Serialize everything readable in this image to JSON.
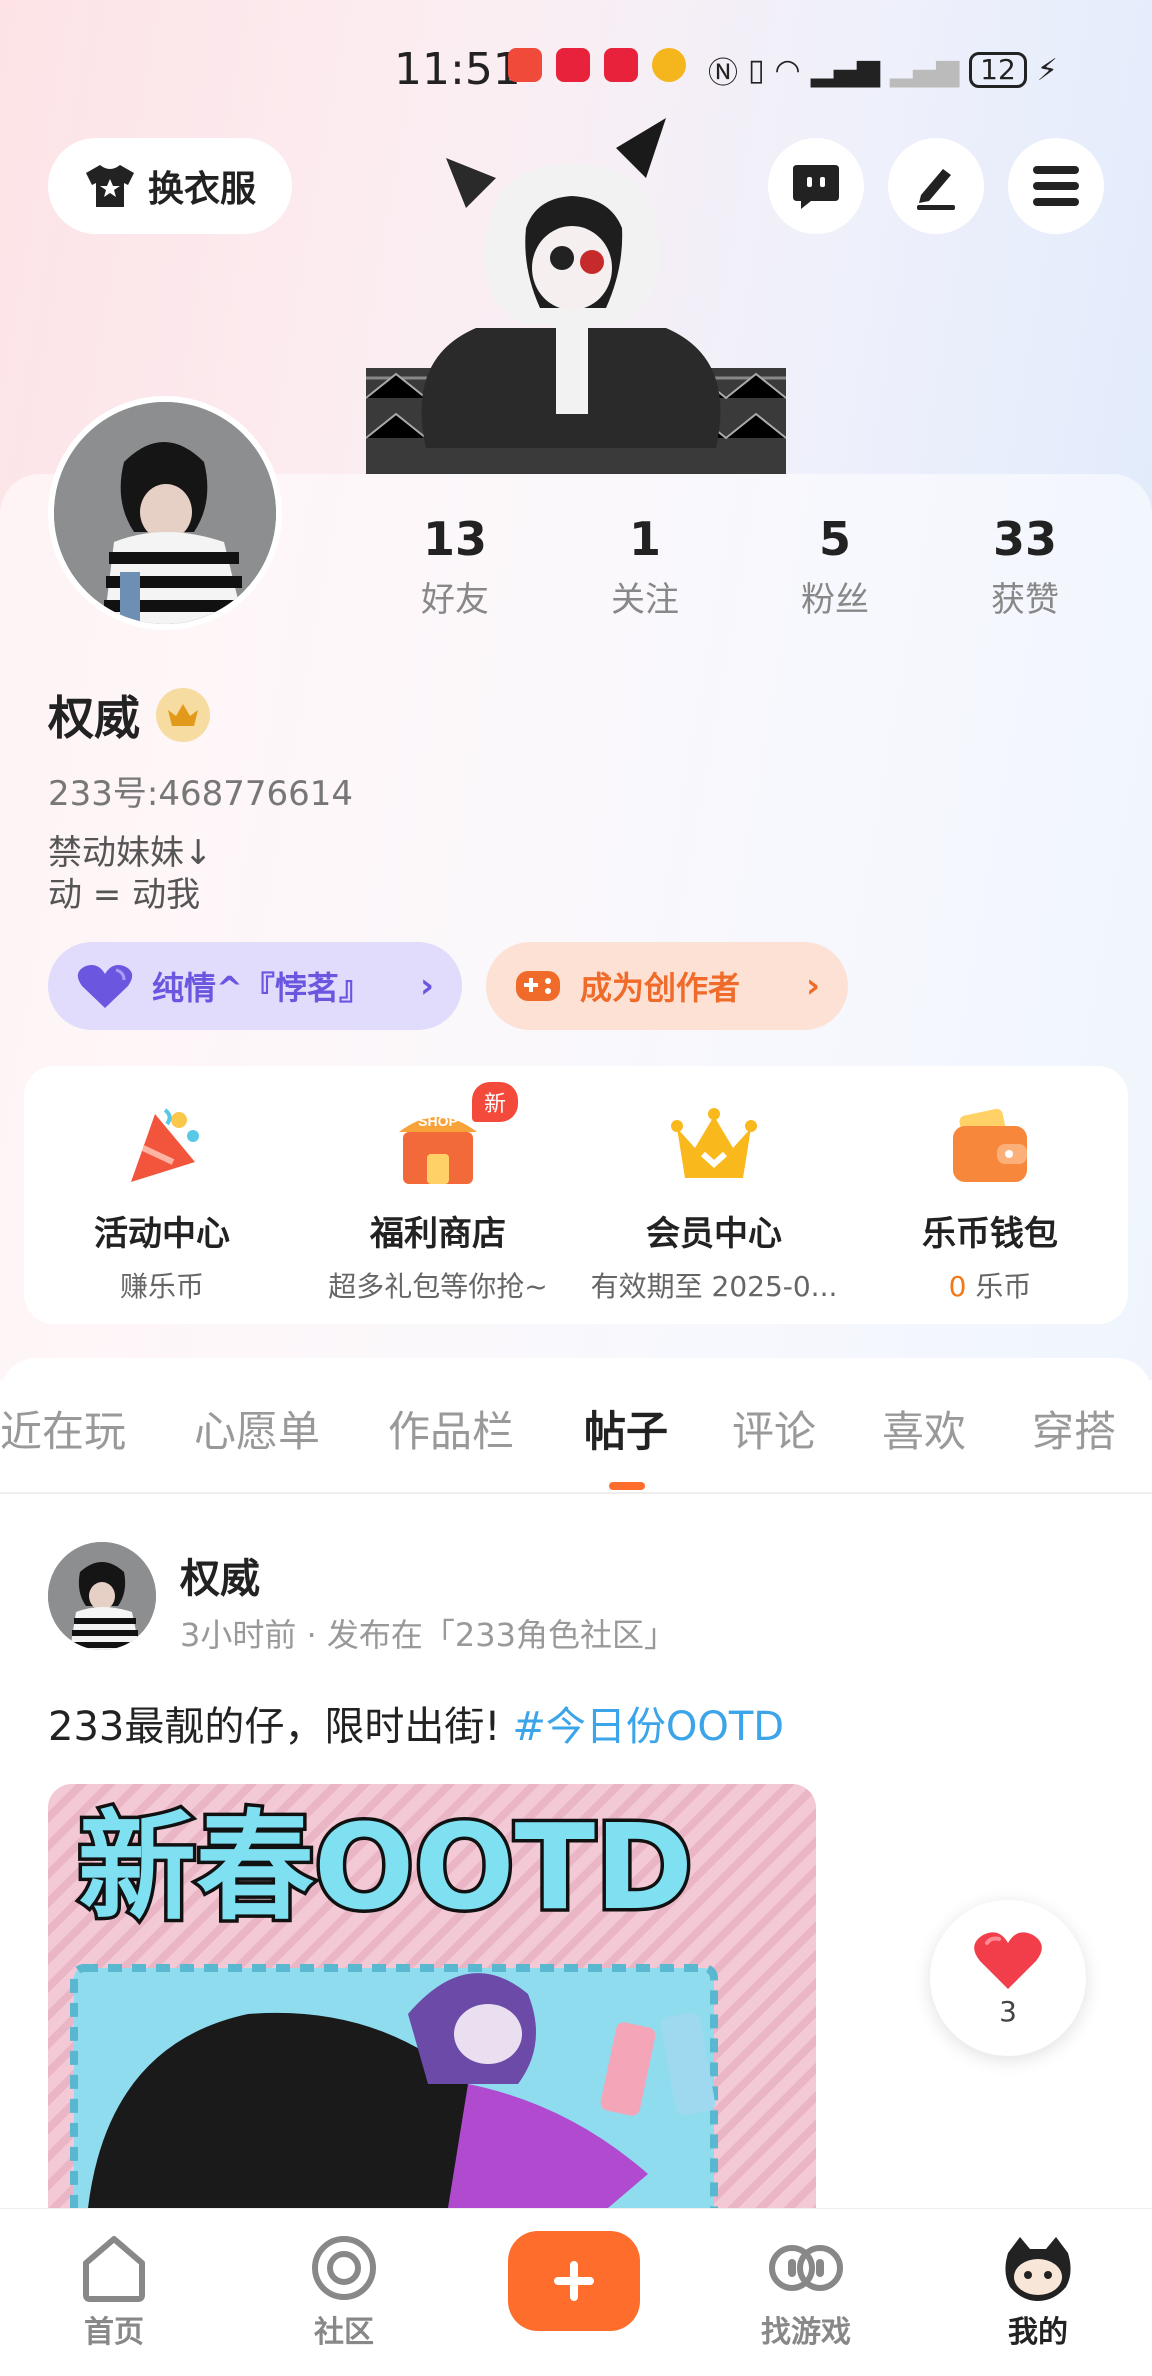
{
  "status_bar": {
    "time": "11:51",
    "battery": "12"
  },
  "header": {
    "outfit_button": "换衣服",
    "icons": [
      "chat-icon",
      "edit-icon",
      "menu-icon"
    ]
  },
  "profile": {
    "stats": [
      {
        "value": "13",
        "label": "好友"
      },
      {
        "value": "1",
        "label": "关注"
      },
      {
        "value": "5",
        "label": "粉丝"
      },
      {
        "value": "33",
        "label": "获赞"
      }
    ],
    "name": "权威",
    "uid": "233号:468776614",
    "bio": "禁动妹妹↓\n动 = 动我",
    "relation_pill": "纯情^『悖茗』",
    "creator_pill": "成为创作者"
  },
  "services": [
    {
      "title": "活动中心",
      "subtitle": "赚乐币",
      "icon": "party-icon"
    },
    {
      "title": "福利商店",
      "subtitle": "超多礼包等你抢~",
      "badge": "新",
      "icon": "shop-icon"
    },
    {
      "title": "会员中心",
      "subtitle": "有效期至 2025-0...",
      "icon": "crown-icon"
    },
    {
      "title": "乐币钱包",
      "subtitle_num": "0",
      "subtitle": "乐币",
      "icon": "wallet-icon"
    }
  ],
  "tabs": [
    "近在玩",
    "心愿单",
    "作品栏",
    "帖子",
    "评论",
    "喜欢",
    "穿搭"
  ],
  "active_tab": "帖子",
  "post": {
    "author": "权威",
    "meta": "3小时前 · 发布在「233角色社区」",
    "text": "233最靓的仔，限时出街!",
    "tag": "#今日份OOTD",
    "image_text": "新春OOTD",
    "likes": "3"
  },
  "bottom_nav": [
    {
      "label": "首页",
      "icon": "home-icon"
    },
    {
      "label": "社区",
      "icon": "community-icon"
    },
    {
      "label": "找游戏",
      "icon": "games-icon"
    },
    {
      "label": "我的",
      "icon": "profile-icon",
      "active": true
    }
  ],
  "colors": {
    "accent": "#ff6d2d",
    "tag": "#3ca4e8",
    "purple": "#6b56e0"
  }
}
